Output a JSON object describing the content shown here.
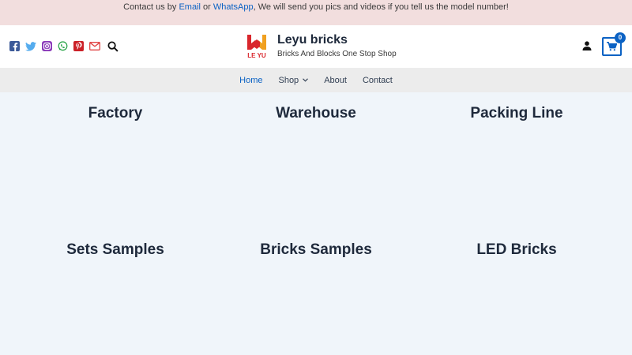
{
  "topbar": {
    "text_before": "Contact us by ",
    "email_link": "Email",
    "text_or": " or ",
    "whatsapp_link": "WhatsApp",
    "text_after": ", We will send you pics and videos if you tell us the model number!"
  },
  "header": {
    "socials": [
      "facebook-icon",
      "twitter-icon",
      "instagram-icon",
      "whatsapp-icon",
      "pinterest-icon",
      "email-icon"
    ],
    "site_title": "Leyu bricks",
    "tagline": "Bricks And Blocks One Stop Shop",
    "logo_text": "LE YU",
    "cart_count": "0"
  },
  "nav": {
    "items": [
      {
        "label": "Home"
      },
      {
        "label": "Shop"
      },
      {
        "label": "About"
      },
      {
        "label": "Contact"
      }
    ]
  },
  "sections": [
    {
      "title": "Factory"
    },
    {
      "title": "Warehouse"
    },
    {
      "title": "Packing Line"
    },
    {
      "title": "Sets Samples"
    },
    {
      "title": "Bricks Samples"
    },
    {
      "title": "LED Bricks"
    }
  ],
  "colors": {
    "accent": "#0b62c4",
    "topbar_bg": "#f2dede",
    "nav_bg": "#ececec",
    "page_bg": "#f0f5fa"
  }
}
